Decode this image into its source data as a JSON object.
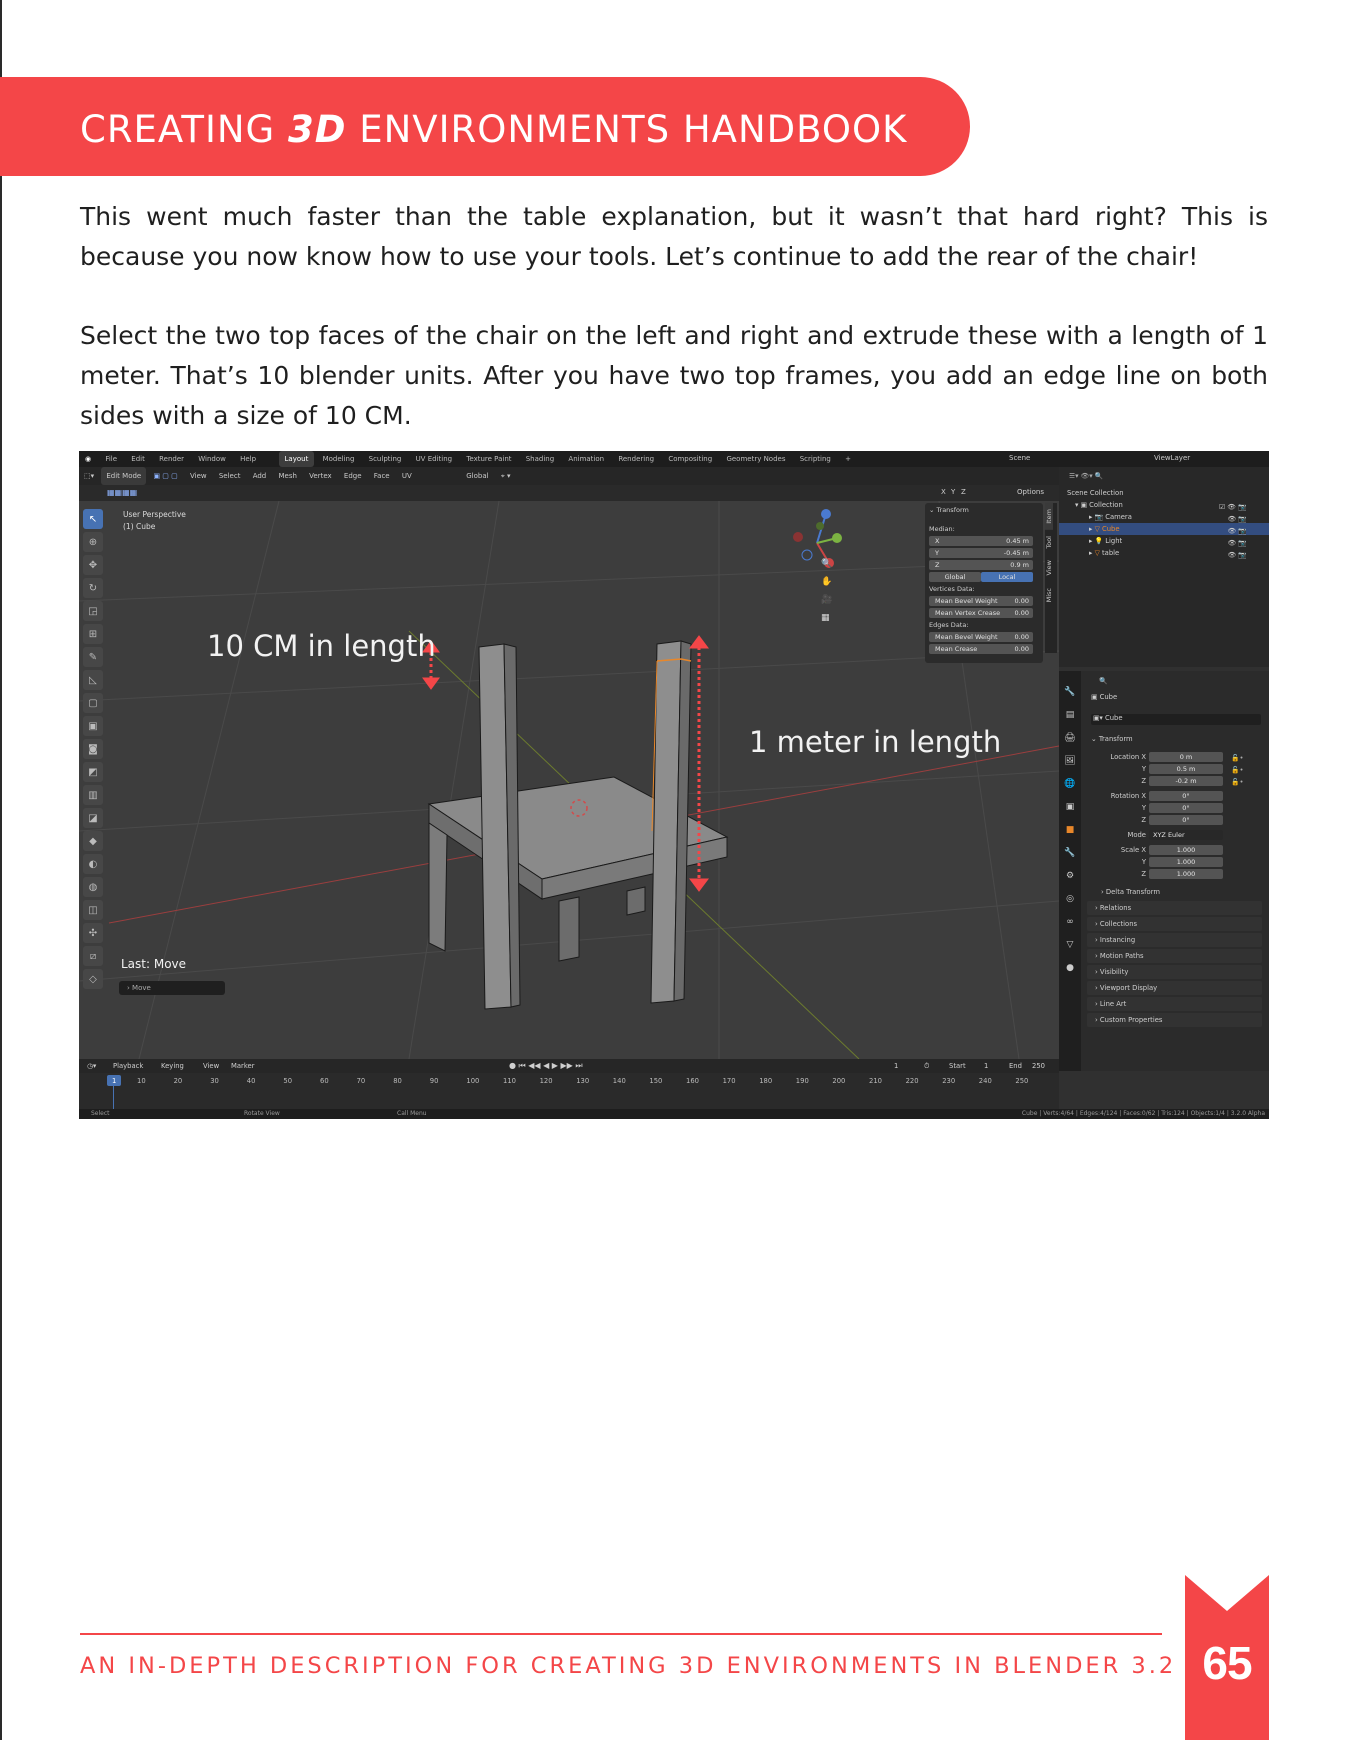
{
  "header": {
    "title_pre": "CREATING ",
    "title_em": "3D",
    "title_post": " ENVIRONMENTS HANDBOOK"
  },
  "paragraphs": [
    "This went much faster than the table explanation, but it wasn’t that hard right? This is because you now know how to use your tools. Let’s continue to add the rear of the chair!",
    "Select the two top faces of the chair on the left and right and extrude these with a length of 1 meter. That’s 10 blender units. After you have two top frames, you add an edge line on both sides with a size of 10 CM."
  ],
  "blender": {
    "menus": [
      "File",
      "Edit",
      "Render",
      "Window",
      "Help"
    ],
    "workspaces": [
      "Layout",
      "Modeling",
      "Sculpting",
      "UV Editing",
      "Texture Paint",
      "Shading",
      "Animation",
      "Rendering",
      "Compositing",
      "Geometry Nodes",
      "Scripting",
      "+"
    ],
    "scene": "Scene",
    "view_layer": "ViewLayer",
    "mode": "Edit Mode",
    "header_menus": [
      "View",
      "Select",
      "Add",
      "Mesh",
      "Vertex",
      "Edge",
      "Face",
      "UV"
    ],
    "orientation": "Global",
    "viewport_label": "User Perspective",
    "viewport_object": "(1) Cube",
    "options_label": "Options",
    "axis_labels": [
      "X",
      "Y",
      "Z"
    ],
    "transform_panel": {
      "title": "Transform",
      "median_label": "Median:",
      "x_label": "X",
      "x_value": "0.45 m",
      "y_label": "Y",
      "y_value": "-0.45 m",
      "z_label": "Z",
      "z_value": "0.9 m",
      "global_label": "Global",
      "local_label": "Local",
      "vertices_data": "Vertices Data:",
      "mean_bevel_weight_v": "Mean Bevel Weight",
      "mean_bevel_weight_v_value": "0.00",
      "mean_vertex_crease": "Mean Vertex Crease",
      "mean_vertex_crease_value": "0.00",
      "edges_data": "Edges Data:",
      "mean_bevel_weight_e": "Mean Bevel Weight",
      "mean_bevel_weight_e_value": "0.00",
      "mean_crease": "Mean Crease",
      "mean_crease_value": "0.00"
    },
    "side_tabs": [
      "Item",
      "Tool",
      "View",
      "Misc"
    ],
    "outliner": {
      "scene_collection": "Scene Collection",
      "collection": "Collection",
      "items": [
        "Camera",
        "Cube",
        "Light",
        "table"
      ]
    },
    "properties": {
      "object_name": "Cube",
      "data_name": "Cube",
      "transform": "Transform",
      "location_label": "Location X",
      "location": [
        "0 m",
        "0.5 m",
        "-0.2 m"
      ],
      "rotation_label": "Rotation X",
      "rotation": [
        "0°",
        "0°",
        "0°"
      ],
      "mode_label": "Mode",
      "mode_value": "XYZ Euler",
      "scale_label": "Scale X",
      "scale": [
        "1.000",
        "1.000",
        "1.000"
      ],
      "yz": [
        "Y",
        "Z"
      ],
      "delta_transform": "Delta Transform",
      "sections": [
        "Relations",
        "Collections",
        "Instancing",
        "Motion Paths",
        "Visibility",
        "Viewport Display",
        "Line Art",
        "Custom Properties"
      ]
    },
    "last_op": "Last: Move",
    "last_op_field": "Move",
    "annotations": {
      "cm": "10 CM in length",
      "meter": "1 meter in length"
    },
    "timeline": {
      "menus": [
        "Playback",
        "Keying",
        "View",
        "Marker"
      ],
      "current_frame": "1",
      "start_label": "Start",
      "start_value": "1",
      "end_label": "End",
      "end_value": "250",
      "ticks": [
        "1",
        "10",
        "20",
        "30",
        "40",
        "50",
        "60",
        "70",
        "80",
        "90",
        "100",
        "110",
        "120",
        "130",
        "140",
        "150",
        "160",
        "170",
        "180",
        "190",
        "200",
        "210",
        "220",
        "230",
        "240",
        "250"
      ]
    },
    "status": {
      "select": "Select",
      "rotate": "Rotate View",
      "call_menu": "Call Menu",
      "stats": "Cube | Verts:4/64 | Edges:4/124 | Faces:0/62 | Tris:124 | Objects:1/4 | 3.2.0 Alpha"
    },
    "colors": {
      "selection": "#4772b3",
      "accent_orange": "#e8872a",
      "arrow_red": "#f44648"
    }
  },
  "footer": {
    "text": "AN IN-DEPTH DESCRIPTION FOR CREATING 3D ENVIRONMENTS IN BLENDER 3.2 +",
    "page_number": "65"
  }
}
